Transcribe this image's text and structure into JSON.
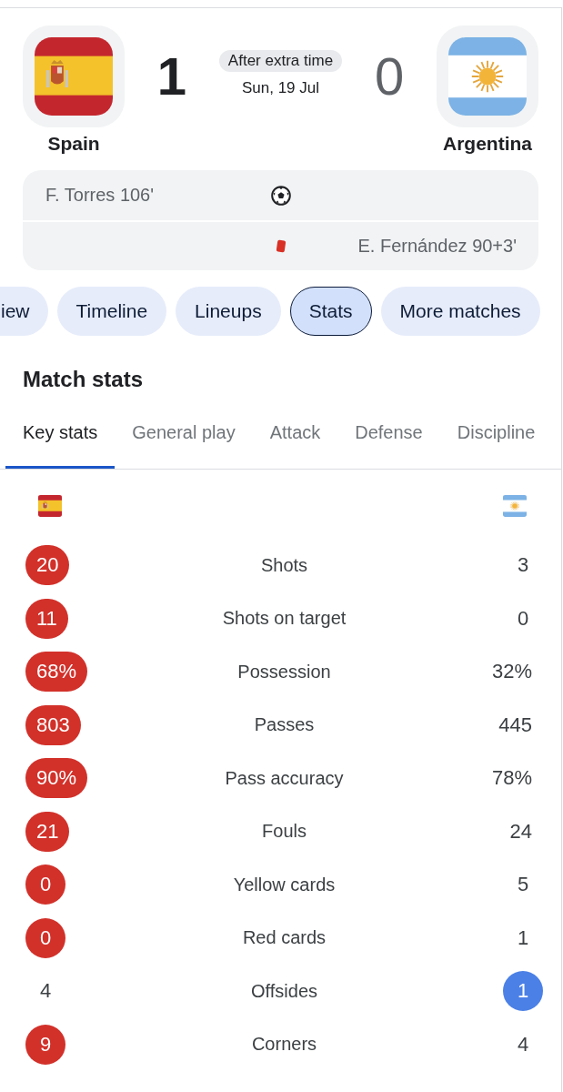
{
  "match": {
    "teams": [
      {
        "name": "Spain",
        "score": "1",
        "winner": true,
        "flag": {
          "kind": "spain"
        }
      },
      {
        "name": "Argentina",
        "score": "0",
        "winner": false,
        "flag": {
          "kind": "argentina"
        }
      }
    ],
    "status": "After extra time",
    "date": "Sun, 19 Jul"
  },
  "events": [
    {
      "kind": "goal",
      "home": "F. Torres 106'"
    },
    {
      "kind": "red_card",
      "away": "E. Fernández 90+3'"
    }
  ],
  "chips": [
    {
      "label": "iew",
      "selected": false
    },
    {
      "label": "Timeline",
      "selected": false
    },
    {
      "label": "Lineups",
      "selected": false
    },
    {
      "label": "Stats",
      "selected": true
    },
    {
      "label": "More matches",
      "selected": false
    }
  ],
  "match_stats": {
    "title": "Match stats",
    "tabs": [
      {
        "label": "Key stats",
        "selected": true
      },
      {
        "label": "General play",
        "selected": false
      },
      {
        "label": "Attack",
        "selected": false
      },
      {
        "label": "Defense",
        "selected": false
      },
      {
        "label": "Discipline",
        "selected": false
      }
    ],
    "rows": [
      {
        "label": "Shots",
        "home": {
          "value": "20",
          "leading": true
        },
        "away": {
          "value": "3",
          "leading": false
        }
      },
      {
        "label": "Shots on target",
        "home": {
          "value": "11",
          "leading": true
        },
        "away": {
          "value": "0",
          "leading": false
        }
      },
      {
        "label": "Possession",
        "home": {
          "value": "68%",
          "leading": true
        },
        "away": {
          "value": "32%",
          "leading": false
        }
      },
      {
        "label": "Passes",
        "home": {
          "value": "803",
          "leading": true
        },
        "away": {
          "value": "445",
          "leading": false
        }
      },
      {
        "label": "Pass accuracy",
        "home": {
          "value": "90%",
          "leading": true
        },
        "away": {
          "value": "78%",
          "leading": false
        }
      },
      {
        "label": "Fouls",
        "home": {
          "value": "21",
          "leading": true
        },
        "away": {
          "value": "24",
          "leading": false
        }
      },
      {
        "label": "Yellow cards",
        "home": {
          "value": "0",
          "leading": true
        },
        "away": {
          "value": "5",
          "leading": false
        }
      },
      {
        "label": "Red cards",
        "home": {
          "value": "0",
          "leading": true
        },
        "away": {
          "value": "1",
          "leading": false
        }
      },
      {
        "label": "Offsides",
        "home": {
          "value": "4",
          "leading": false
        },
        "away": {
          "value": "1",
          "leading": true
        }
      },
      {
        "label": "Corners",
        "home": {
          "value": "9",
          "leading": true
        },
        "away": {
          "value": "4",
          "leading": false
        }
      }
    ]
  }
}
